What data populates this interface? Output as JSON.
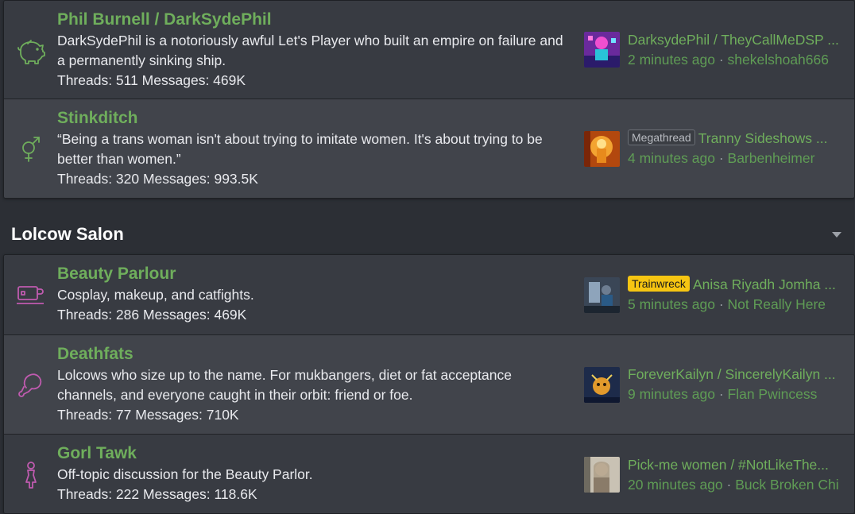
{
  "colors": {
    "page_bg": "#2c2f35",
    "node_bg_odd": "#383b42",
    "node_bg_even": "#41444b",
    "link_green": "#6fae5c",
    "icon_green": "#6fae5c",
    "icon_pink": "#c05bb0",
    "trainwreck_yellow": "#f6c512"
  },
  "section1": {
    "nodes": [
      {
        "icon": "piggy-bank-icon",
        "title": "Phil Burnell / DarkSydePhil",
        "description": "DarkSydePhil is a notoriously awful Let's Player who built an empire on failure and a permanently sinking ship.",
        "stats": "Threads: 511 Messages: 469K",
        "latest": {
          "thread": "DarksydePhil / TheyCallMeDSP ...",
          "time": "2 minutes ago",
          "user": "shekelshoah666"
        }
      },
      {
        "icon": "gender-symbol-icon",
        "title": "Stinkditch",
        "description": "“Being a trans woman isn't about trying to imitate women. It's about trying to be better than women.”",
        "stats": "Threads: 320 Messages: 993.5K",
        "latest": {
          "label": "Megathread",
          "thread": "Tranny Sideshows ...",
          "time": "4 minutes ago",
          "user": "Barbenheimer"
        }
      }
    ]
  },
  "category": {
    "title": "Lolcow Salon",
    "toggle_icon": "caret-down-icon"
  },
  "section2": {
    "nodes": [
      {
        "icon": "mug-icon",
        "title": "Beauty Parlour",
        "description": "Cosplay, makeup, and catfights.",
        "stats": "Threads: 286 Messages: 469K",
        "latest": {
          "label": "Trainwreck",
          "thread": "Anisa Riyadh Jomha ...",
          "time": "5 minutes ago",
          "user": "Not Really Here"
        }
      },
      {
        "icon": "drumstick-icon",
        "title": "Deathfats",
        "description": "Lolcows who size up to the name. For mukbangers, diet or fat acceptance channels, and everyone caught in their orbit: friend or foe.",
        "stats": "Threads: 77 Messages: 710K",
        "latest": {
          "thread": "ForeverKailyn / SincerelyKailyn ...",
          "time": "9 minutes ago",
          "user": "Flan Pwincess"
        }
      },
      {
        "icon": "female-figure-icon",
        "title": "Gorl Tawk",
        "description": "Off-topic discussion for the Beauty Parlor.",
        "stats": "Threads: 222 Messages: 118.6K",
        "latest": {
          "thread": "Pick-me women / #NotLikeThe...",
          "time": "20 minutes ago",
          "user": "Buck Broken Chi"
        }
      }
    ]
  }
}
